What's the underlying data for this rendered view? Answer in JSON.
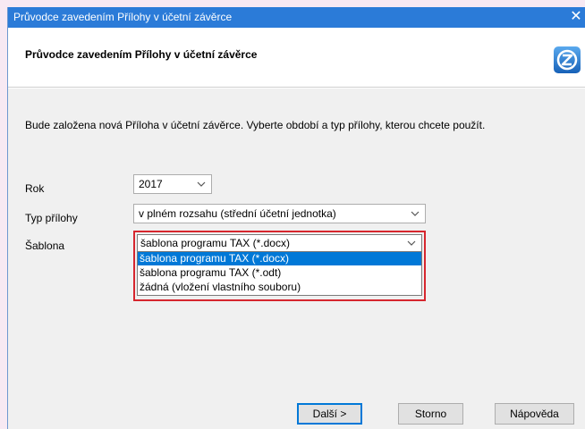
{
  "window": {
    "title": "Průvodce zavedením Přílohy v účetní závěrce",
    "close_glyph": "✕"
  },
  "header": {
    "heading": "Průvodce zavedením Přílohy v účetní závěrce",
    "logo_icon": "z-logo-icon"
  },
  "intro_text": "Bude založena nová Příloha v účetní závěrce. Vyberte období a typ přílohy, kterou chcete použít.",
  "form": {
    "rok": {
      "label": "Rok",
      "value": "2017"
    },
    "typ": {
      "label": "Typ přílohy",
      "value": "v plném rozsahu (střední účetní jednotka)"
    },
    "sablona": {
      "label": "Šablona",
      "value": "šablona programu TAX (*.docx)",
      "options": [
        "šablona programu TAX (*.docx)",
        "šablona programu TAX (*.odt)",
        "žádná (vložení vlastního souboru)"
      ],
      "highlight_color": "#d6262e"
    }
  },
  "buttons": {
    "next": "Další >",
    "cancel": "Storno",
    "help": "Nápověda"
  },
  "colors": {
    "titlebar": "#2b7bd8",
    "selection": "#0078d7"
  }
}
